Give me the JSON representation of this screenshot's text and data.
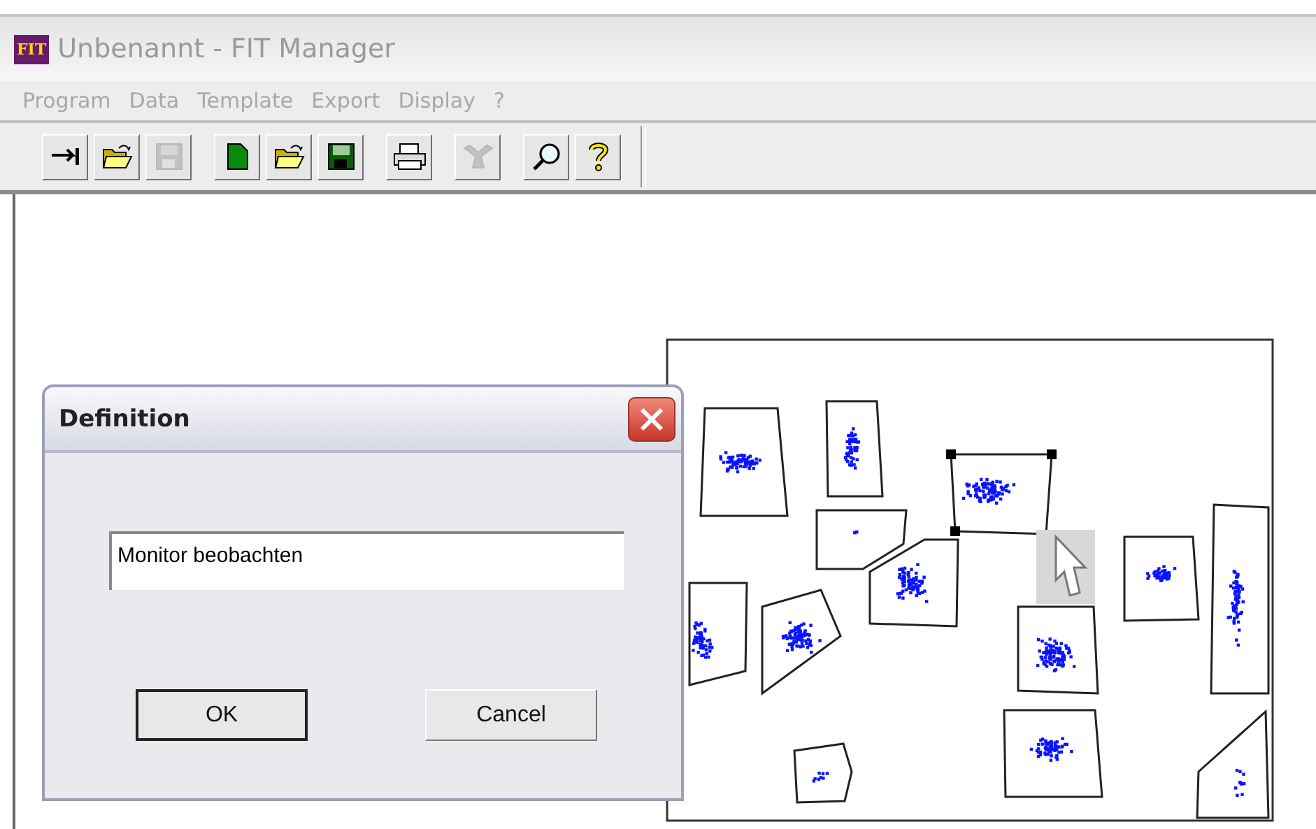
{
  "window": {
    "app_icon_text": "FIT",
    "title": "Unbenannt - FIT Manager"
  },
  "menu": [
    "Program",
    "Data",
    "Template",
    "Export",
    "Display",
    "?"
  ],
  "toolbar": [
    {
      "kind": "exit",
      "disabled": false
    },
    {
      "kind": "open",
      "disabled": false
    },
    {
      "kind": "save",
      "disabled": true
    },
    {
      "kind": "new",
      "disabled": false
    },
    {
      "kind": "open",
      "disabled": false
    },
    {
      "kind": "save",
      "disabled": false
    },
    {
      "kind": "print",
      "disabled": false
    },
    {
      "kind": "tool",
      "disabled": true
    },
    {
      "kind": "zoom",
      "disabled": false
    },
    {
      "kind": "help",
      "disabled": false
    }
  ],
  "canvas": {
    "regions": [
      {
        "selected": false
      },
      {
        "selected": false
      },
      {
        "selected": false
      },
      {
        "selected": true
      },
      {
        "selected": false
      },
      {
        "selected": false
      },
      {
        "selected": false
      },
      {
        "selected": false
      },
      {
        "selected": false
      },
      {
        "selected": false
      },
      {
        "selected": false
      },
      {
        "selected": false
      },
      {
        "selected": false
      }
    ]
  },
  "dialog": {
    "title": "Definition",
    "field": {
      "value": "Monitor beobachten"
    },
    "buttons": [
      {
        "label": "OK",
        "default": true
      },
      {
        "label": "Cancel",
        "default": false
      }
    ]
  }
}
